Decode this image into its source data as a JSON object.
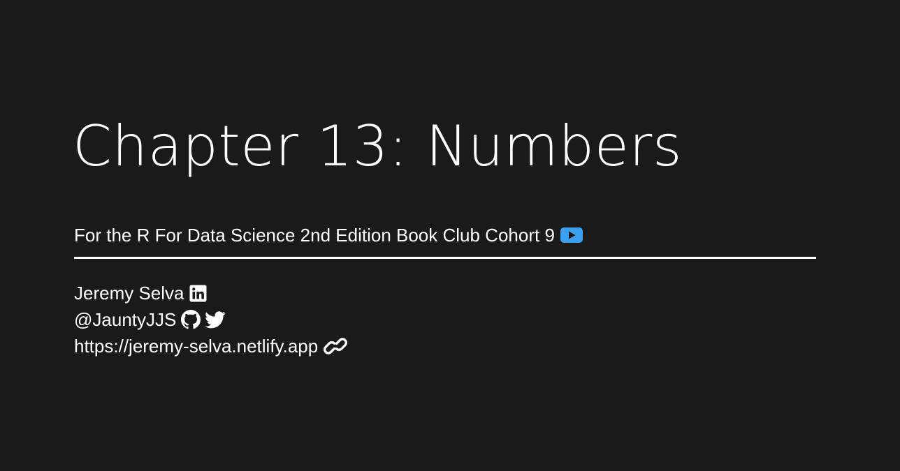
{
  "slide": {
    "title": "Chapter 13: Numbers",
    "subtitle": "For the R For Data Science 2nd Edition Book Club Cohort 9",
    "author": {
      "name": "Jeremy Selva",
      "handle": "@JauntyJJS",
      "website": "https://jeremy-selva.netlify.app"
    }
  },
  "icons": {
    "subtitle": "youtube-icon",
    "name": "linkedin-icon",
    "handle": [
      "github-icon",
      "twitter-icon"
    ],
    "website": "link-icon"
  },
  "colors": {
    "background": "#1a1a1a",
    "text": "#ffffff",
    "youtube_accent": "#3ba0f0"
  }
}
